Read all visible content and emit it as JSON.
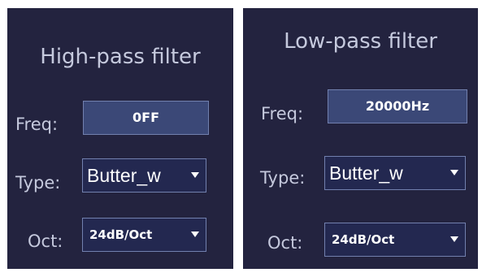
{
  "high_pass": {
    "title": "High-pass filter",
    "freq_label": "Freq:",
    "freq_value": "0FF",
    "type_label": "Type:",
    "type_value": "Butter_w",
    "oct_label": "Oct:",
    "oct_value": "24dB/Oct"
  },
  "low_pass": {
    "title": "Low-pass filter",
    "freq_label": "Freq:",
    "freq_value": "20000Hz",
    "type_label": "Type:",
    "type_value": "Butter_w",
    "oct_label": "Oct:",
    "oct_value": "24dB/Oct"
  },
  "icons": {
    "dropdown": "chevron-down-icon"
  },
  "colors": {
    "panel_bg": "#23233f",
    "field_bg": "#3b4877",
    "select_bg": "#232850",
    "border": "#7280ae",
    "label_text": "#c5c9dd",
    "value_text": "#ffffff"
  }
}
